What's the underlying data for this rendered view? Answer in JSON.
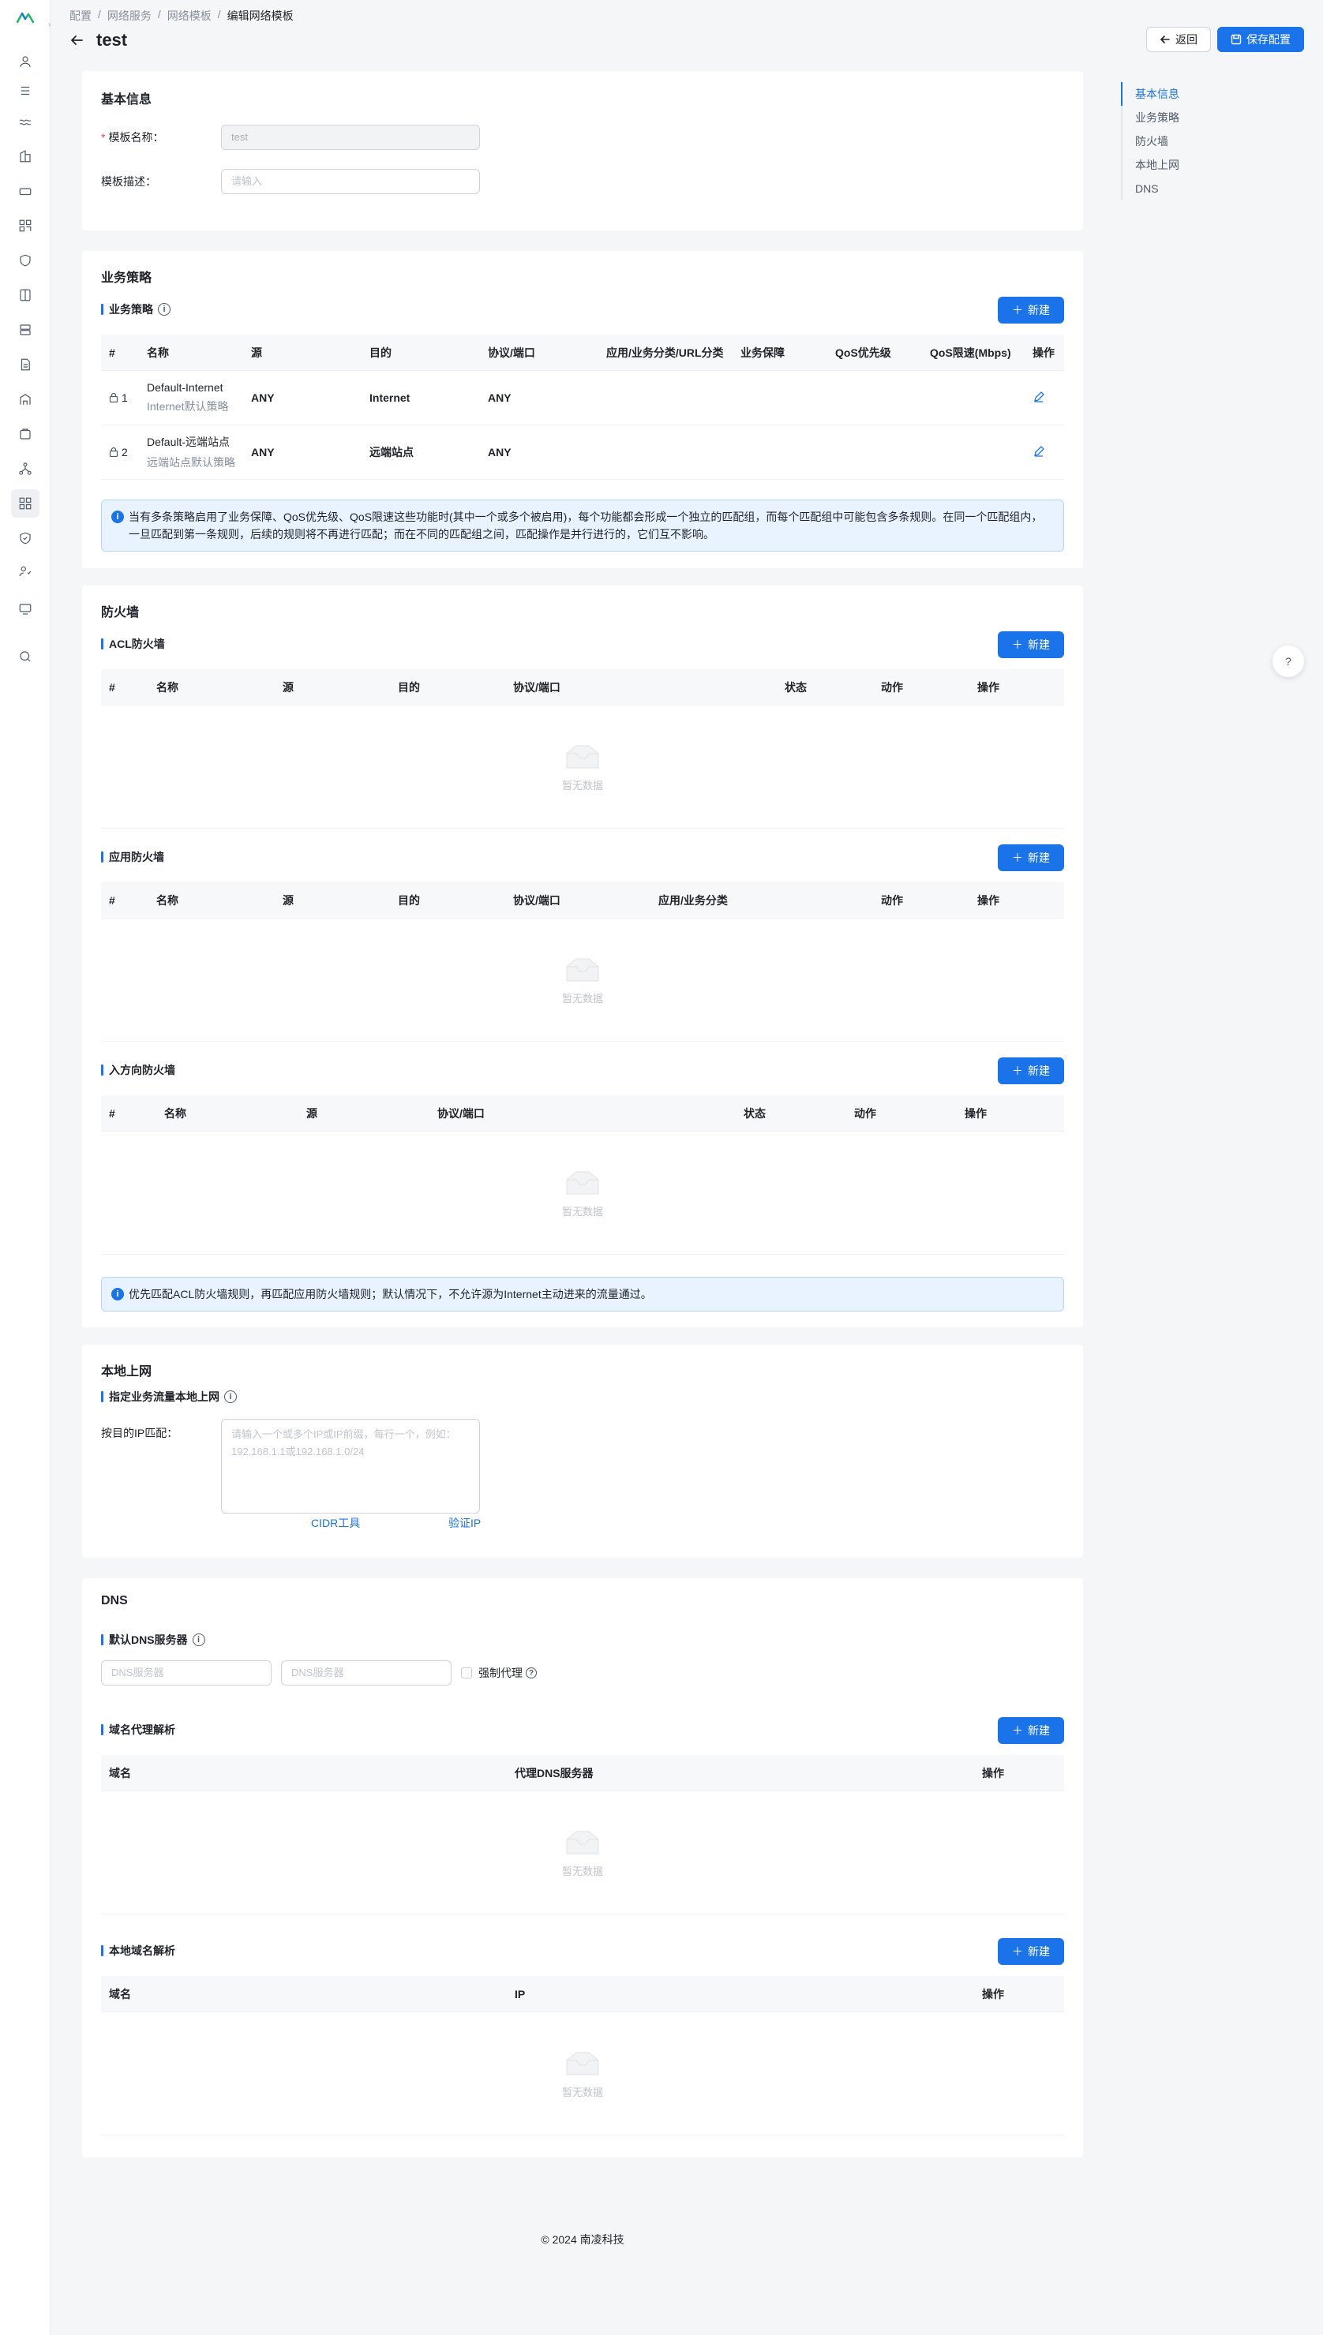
{
  "breadcrumb": [
    "配置",
    "网络服务",
    "网络模板",
    "编辑网络模板"
  ],
  "page": {
    "title": "test",
    "back_label": "返回",
    "save_label": "保存配置"
  },
  "anchor": [
    "基本信息",
    "业务策略",
    "防火墙",
    "本地上网",
    "DNS"
  ],
  "basic": {
    "title": "基本信息",
    "name_label": "模板名称：",
    "name_value": "test",
    "desc_label": "模板描述：",
    "desc_placeholder": "请输入"
  },
  "policy": {
    "title": "业务策略",
    "sub_title": "业务策略",
    "new_label": "新建",
    "columns": [
      "#",
      "名称",
      "源",
      "目的",
      "协议/端口",
      "应用/业务分类/URL分类",
      "业务保障",
      "QoS优先级",
      "QoS限速(Mbps)",
      "操作"
    ],
    "rows": [
      {
        "idx": "1",
        "name": "Default-Internet",
        "desc": "Internet默认策略",
        "src": "ANY",
        "dst": "Internet",
        "proto": "ANY"
      },
      {
        "idx": "2",
        "name": "Default-远端站点",
        "desc": "远端站点默认策略",
        "src": "ANY",
        "dst": "远端站点",
        "proto": "ANY"
      }
    ],
    "alert": "当有多条策略启用了业务保障、QoS优先级、QoS限速这些功能时(其中一个或多个被启用)，每个功能都会形成一个独立的匹配组，而每个匹配组中可能包含多条规则。在同一个匹配组内，一旦匹配到第一条规则，后续的规则将不再进行匹配；而在不同的匹配组之间，匹配操作是并行进行的，它们互不影响。"
  },
  "firewall": {
    "title": "防火墙",
    "acl_title": "ACL防火墙",
    "acl_columns": [
      "#",
      "名称",
      "源",
      "目的",
      "协议/端口",
      "状态",
      "动作",
      "操作"
    ],
    "app_title": "应用防火墙",
    "app_columns": [
      "#",
      "名称",
      "源",
      "目的",
      "协议/端口",
      "应用/业务分类",
      "动作",
      "操作"
    ],
    "in_title": "入方向防火墙",
    "in_columns": [
      "#",
      "名称",
      "源",
      "协议/端口",
      "状态",
      "动作",
      "操作"
    ],
    "new_label": "新建",
    "empty_text": "暂无数据",
    "alert": "优先匹配ACL防火墙规则，再匹配应用防火墙规则；默认情况下，不允许源为Internet主动进来的流量通过。"
  },
  "local": {
    "title": "本地上网",
    "sub_title": "指定业务流量本地上网",
    "ip_label": "按目的IP匹配：",
    "ip_placeholder": "请输入一个或多个IP或IP前缀，每行一个，例如：192.168.1.1或192.168.1.0/24",
    "cidr_link": "CIDR工具",
    "verify_link": "验证IP"
  },
  "dns": {
    "title": "DNS",
    "default_title": "默认DNS服务器",
    "dns_placeholder": "DNS服务器",
    "proxy_label": "强制代理",
    "proxy_title": "域名代理解析",
    "proxy_columns": [
      "域名",
      "代理DNS服务器",
      "操作"
    ],
    "local_title": "本地域名解析",
    "local_columns": [
      "域名",
      "IP",
      "操作"
    ],
    "new_label": "新建",
    "empty_text": "暂无数据"
  },
  "footer": "© 2024 南凌科技",
  "colors": {
    "primary": "#1a73e8",
    "bg": "#f5f6f8",
    "alert_bg": "#e8f3ff"
  }
}
